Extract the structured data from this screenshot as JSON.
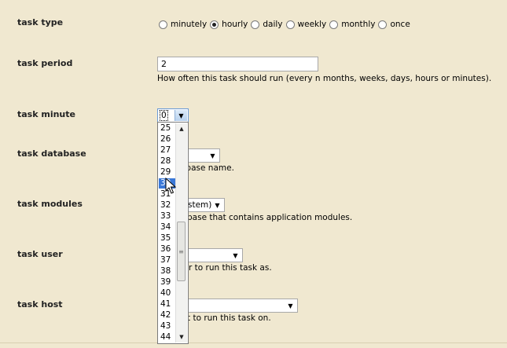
{
  "task_type": {
    "label": "task type",
    "options": [
      {
        "label": "minutely",
        "checked": false
      },
      {
        "label": "hourly",
        "checked": true
      },
      {
        "label": "daily",
        "checked": false
      },
      {
        "label": "weekly",
        "checked": false
      },
      {
        "label": "monthly",
        "checked": false
      },
      {
        "label": "once",
        "checked": false
      }
    ]
  },
  "task_period": {
    "label": "task period",
    "value": "2",
    "help": "How often this task should run (every n months, weeks, days, hours or minutes)."
  },
  "task_minute": {
    "label": "task minute",
    "value": "0",
    "options": [
      "25",
      "26",
      "27",
      "28",
      "29",
      "30",
      "31",
      "32",
      "33",
      "34",
      "35",
      "36",
      "37",
      "38",
      "39",
      "40",
      "41",
      "42",
      "43",
      "44"
    ],
    "highlighted": "30"
  },
  "task_database": {
    "label": "task database",
    "help_partial": "abase name."
  },
  "task_modules": {
    "label": "task modules",
    "value_partial": "stem)",
    "help_partial": "base that contains application modules."
  },
  "task_user": {
    "label": "task user",
    "help_partial": "r to run this task as."
  },
  "task_host": {
    "label": "task host",
    "help_partial": "t to run this task on."
  },
  "icons": {
    "dropdown_arrow": "▼",
    "scroll_up": "▲",
    "scroll_down": "▼",
    "thumb_grip": "≡"
  }
}
